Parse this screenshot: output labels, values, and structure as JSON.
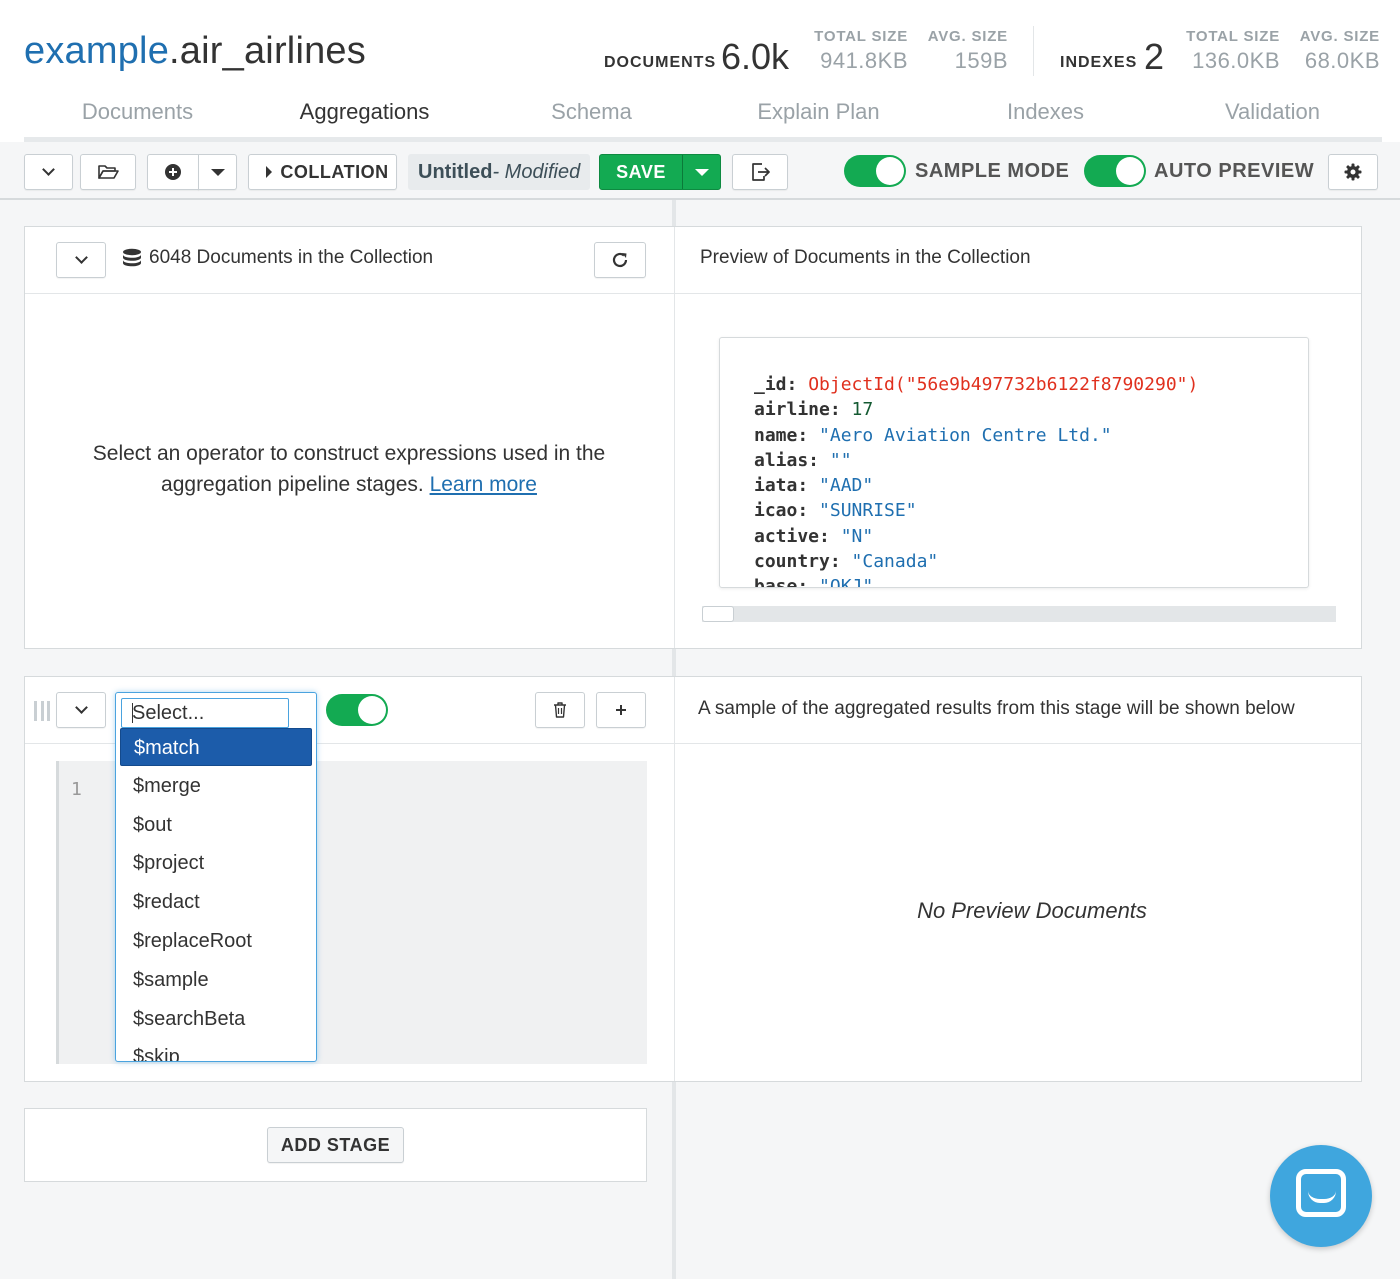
{
  "namespace": {
    "db": "example",
    "collection": ".air_airlines"
  },
  "stats": {
    "documents_label": "DOCUMENTS",
    "documents_count": "6.0k",
    "doc_total_size_label": "TOTAL SIZE",
    "doc_total_size": "941.8KB",
    "doc_avg_size_label": "AVG. SIZE",
    "doc_avg_size": "159B",
    "indexes_label": "INDEXES",
    "indexes_count": "2",
    "idx_total_size_label": "TOTAL SIZE",
    "idx_total_size": "136.0KB",
    "idx_avg_size_label": "AVG. SIZE",
    "idx_avg_size": "68.0KB"
  },
  "tabs": [
    {
      "label": "Documents"
    },
    {
      "label": "Aggregations"
    },
    {
      "label": "Schema"
    },
    {
      "label": "Explain Plan"
    },
    {
      "label": "Indexes"
    },
    {
      "label": "Validation"
    }
  ],
  "toolbar": {
    "collation_label": "COLLATION",
    "pipeline_name": "Untitled",
    "pipeline_state": "- Modified",
    "save_label": "SAVE",
    "sample_mode_label": "SAMPLE MODE",
    "auto_preview_label": "AUTO PREVIEW"
  },
  "source_stage": {
    "count_text": "6048 Documents in the Collection",
    "help_text_1": "Select an operator to construct expressions used in the",
    "help_text_2": "aggregation pipeline stages.",
    "learn_more": "Learn more",
    "preview_title": "Preview of Documents in the Collection"
  },
  "document": {
    "fields": [
      {
        "key": "_id:",
        "value": "ObjectId(\"56e9b497732b6122f8790290\")",
        "kind": "oid"
      },
      {
        "key": "airline:",
        "value": "17",
        "kind": "num"
      },
      {
        "key": "name:",
        "value": "\"Aero Aviation Centre Ltd.\"",
        "kind": "str"
      },
      {
        "key": "alias:",
        "value": "\"\"",
        "kind": "str"
      },
      {
        "key": "iata:",
        "value": "\"AAD\"",
        "kind": "str"
      },
      {
        "key": "icao:",
        "value": "\"SUNRISE\"",
        "kind": "str"
      },
      {
        "key": "active:",
        "value": "\"N\"",
        "kind": "str"
      },
      {
        "key": "country:",
        "value": "\"Canada\"",
        "kind": "str"
      },
      {
        "key": "base:",
        "value": "\"OKJ\"",
        "kind": "str"
      }
    ]
  },
  "stage": {
    "select_placeholder": "Select...",
    "options": [
      "$match",
      "$merge",
      "$out",
      "$project",
      "$redact",
      "$replaceRoot",
      "$sample",
      "$searchBeta",
      "$skip"
    ],
    "selected_option": "$match",
    "line_number": "1",
    "preview_hint": "A sample of the aggregated results from this stage will be shown below",
    "no_preview": "No Preview Documents"
  },
  "add_stage_label": "ADD STAGE",
  "colors": {
    "accent": "#13aa52",
    "link": "#1f6fb0",
    "selected": "#1c5caa",
    "help": "#3fa6de"
  }
}
